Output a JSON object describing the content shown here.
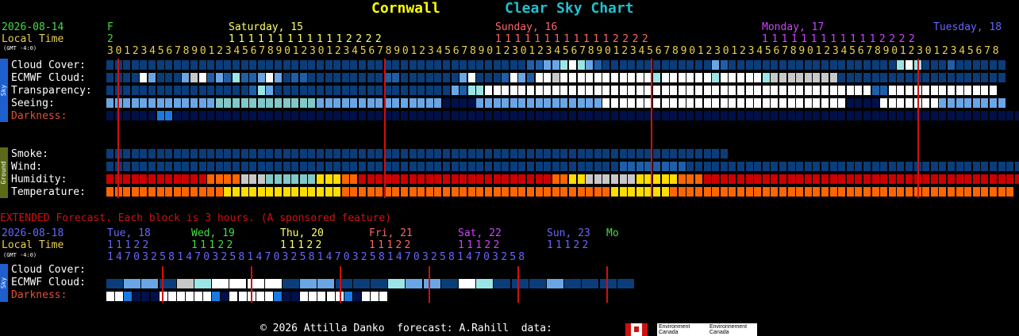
{
  "header": {
    "location": "Cornwall",
    "chart_name": "Clear Sky Chart",
    "location_color": "#ffff00",
    "chart_name_color": "#20c0d0"
  },
  "main": {
    "date": "2026-08-14",
    "local_time": "Local Time",
    "gmt": "(GMT -4:0)",
    "day_f": "F",
    "day_f_num": "2",
    "days": [
      {
        "label": "Saturday, 15",
        "color": "#ffff66",
        "tens": "1111111111112222"
      },
      {
        "label": "Sunday, 16",
        "color": "#ff6666",
        "tens": "1111111111112222"
      },
      {
        "label": "Monday, 17",
        "color": "#cc44ff",
        "tens": "1111111111112222"
      },
      {
        "label": "Tuesday, 18",
        "color": "#6666ff",
        "tens": ""
      }
    ],
    "hours_text": "3012345678901234567890123012345678901234567890123012345678901234567890123012345678901234567890123012345678",
    "rows": [
      {
        "label": "Cloud Cover:",
        "color": "#ffffff"
      },
      {
        "label": "ECMWF Cloud:",
        "color": "#ffffff"
      },
      {
        "label": "Transparency:",
        "color": "#ffffff"
      },
      {
        "label": "Seeing:",
        "color": "#ffffff"
      },
      {
        "label": "Darkness:",
        "color": "#e05030"
      },
      {
        "label": "Smoke:",
        "color": "#ffffff"
      },
      {
        "label": "Wind:",
        "color": "#ffffff"
      },
      {
        "label": "Humidity:",
        "color": "#ffffff"
      },
      {
        "label": "Temperature:",
        "color": "#ffffff"
      }
    ],
    "side_tabs": {
      "sky": "Sky",
      "ground": "Ground"
    },
    "rows_data": {
      "cloud": "DDDDDDDDDDDDDDDDDDDDDDDDDDDDDDDDDDDDDDDDDDDDDDDDDDMMLLCWCLMDDDDDDDDDDDDDLMDDDDDDDDDDDDDDDDDDDDCWCDDDMDDDDDD",
      "ecmwf": "DDDDWLDDDLGWMLMCMMLWLDMMDDDDDDDDDMMDDDDDDDLWDDDMWLMWWGWWWWWWWWWWWCWWWWWWCWWWWWCGGGGGGGGDDDDDDDDDDDDDDDDDDDD",
      "transparency": "DDDDDDDDDDDDDDDDDMCLDDDDDDDDDDDDDDDDDDDDDLMCCWWWWWWWWWWWWWWWWWWWWWWWWWWWWWWWWWWWWWWWWWWWWWWMMWWWWWWWWWWWWW",
      "seeing": "LLLLLLLLLLLLLTTTTTTTTTTTTLLLLLLLLLLLLLLLNNNNLLLLLLLLLLLLLLLWWWWWWWWWWWWWWWWWWWWWWWWWWWWWNNNNWWWWWWWLLLLLLLL",
      "darkness": "NNNNNNBBNNNNNNNNNNNNNNNNNNNNNNNNNNNNNNNNNNNNNNNNNNNNNNNNNNNNNNNNNNNNNNNNNNNNNNNNNNNNNNNNNNNNNNNNNNNNNNNNNNNNNN",
      "smoke": "DDDDDDDDDDDDDDDDDDDDDDDDDDDDDDDDDDDDDDDDDDDDDDDDDDDDDDDDDDDDDDDDDDDDDDDDDD",
      "wind": "DDDDDDDDDDDDDDDDDDDDDDDDDDDDDDDDDDDDDDDDDDDDDDDDDDDDDDDDDDDDDMMMMMMMMDDDDDDDDDDDDDDDDDDDDDDDDDDDDDDDDDDDDDDDDD",
      "humidity": "RRRRRRRRRRRROOOOGGGTTTTTTYYYOORRRRRRRRRRRRRRRRRRRRRRROOYYGGGGGGYYYYYOOORRRRRRRRRRRRRRRRRRRRRRRRRRRRRRRRRRRRRRR",
      "temperature": "OOOOOOOOOOOOOOYYYYYYYYYYYYYYOOOOOOOOOOOOOOOOOOOOOOOOOOOOOOOOYYYYYYYOOOOOOOOOOOOOOOOOOOOOOOOOOOOOOOOOOOOOOOOO"
    }
  },
  "extended": {
    "note": "EXTENDED Forecast. Each block is 3 hours. (A sponsored feature)",
    "date": "2026-08-18",
    "local_time": "Local Time",
    "gmt": "(GMT -4:0)",
    "days": [
      {
        "label": "Tue, 18",
        "color": "#6666ff",
        "tens": "11122"
      },
      {
        "label": "Wed, 19",
        "color": "#44dd44",
        "tens": "11122"
      },
      {
        "label": "Thu, 20",
        "color": "#ffff66",
        "tens": "11122"
      },
      {
        "label": "Fri, 21",
        "color": "#ff6666",
        "tens": "11122"
      },
      {
        "label": "Sat, 22",
        "color": "#cc44ff",
        "tens": "11122"
      },
      {
        "label": "Sun, 23",
        "color": "#6666ff",
        "tens": "11122"
      },
      {
        "label": "Mo",
        "color": "#44dd44",
        "tens": ""
      }
    ],
    "hours_text": "147032581470325814703258147032581470325814703258",
    "rows": [
      {
        "label": "Cloud Cover:",
        "color": "#ffffff"
      },
      {
        "label": "ECMWF Cloud:",
        "color": "#ffffff"
      },
      {
        "label": "Darkness:",
        "color": "#e05030"
      }
    ],
    "rows_data": {
      "cloud": "",
      "ecmwf": "DLLDGCWWWWDLLDDDCLLDWCDDDLDDDD",
      "darkness": "WWBNNNWWWWWWBNWWWWWBNNWWWWWBNWWW"
    }
  },
  "footer": {
    "copyright": "© 2026 Attilla Danko  forecast: A.Rahill  data:",
    "env_en": "Environment Canada",
    "env_fr": "Environnement Canada"
  },
  "colors": {
    "D": "#0a3d7a",
    "M": "#1f5fa8",
    "L": "#6aa6e6",
    "C": "#9ae6e6",
    "W": "#ffffff",
    "G": "#c8c8c8",
    "T": "#82c8c8",
    "N": "#001048",
    "B": "#1a7ae0",
    "R": "#cc0000",
    "O": "#ff6600",
    "Y": "#ffdd00",
    "grid_line": "#d01010"
  }
}
